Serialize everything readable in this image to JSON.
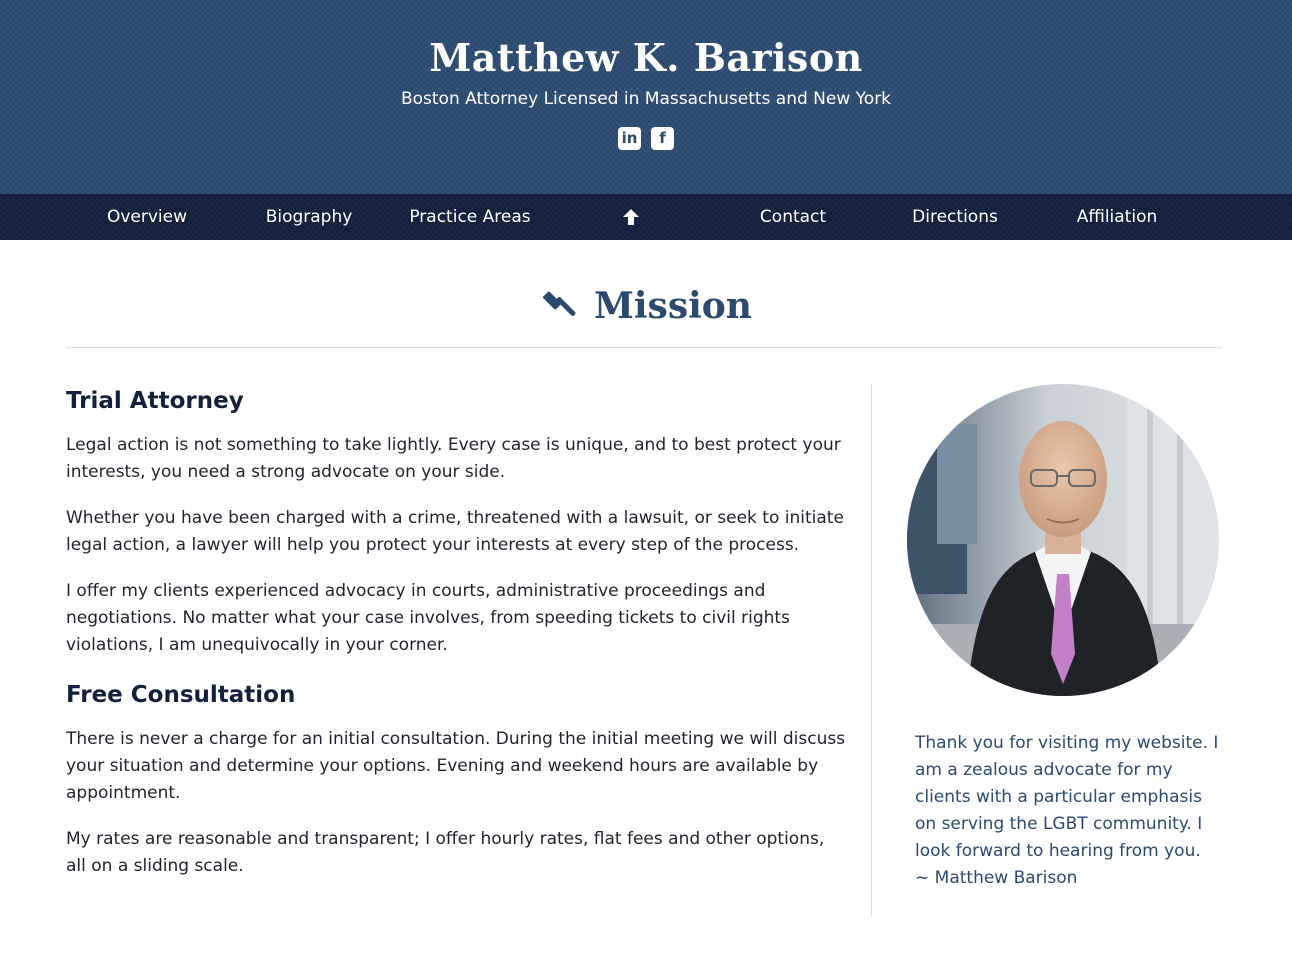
{
  "header": {
    "title": "Matthew K. Barison",
    "subtitle": "Boston Attorney Licensed in Massachusetts and New York",
    "social": [
      {
        "icon": "linkedin-icon",
        "glyph": "in"
      },
      {
        "icon": "facebook-icon",
        "glyph": "f"
      }
    ]
  },
  "nav": {
    "items": [
      "Overview",
      "Biography",
      "Practice Areas",
      "Contact",
      "Directions",
      "Affiliation"
    ],
    "up_icon": "arrow-up-icon"
  },
  "section": {
    "icon": "gavel-icon",
    "title": "Mission"
  },
  "main": {
    "heading1": "Trial Attorney",
    "p1": "Legal action is not something to take lightly. Every case is unique, and to best protect your interests, you need a strong advocate on your side.",
    "p2": "Whether you have been charged with a crime, threatened with a lawsuit, or seek to initiate legal action, a lawyer will help you protect your interests at every step of the process.",
    "p3": "I offer my clients experienced advocacy in courts, administrative proceedings and negotiations. No matter what your case involves, from speeding tickets to civil rights violations, I am unequivocally in your corner.",
    "heading2": "Free Consultation",
    "p4": "There is never a charge for an initial consultation. During the initial meeting we will discuss your situation and determine your options. Evening and weekend hours are available by appointment.",
    "p5": "My rates are reasonable and transparent; I offer hourly rates, flat fees and other options, all on a sliding scale."
  },
  "sidebar": {
    "message": "Thank you for visiting my website. I am a zealous advocate for my clients with a particular emphasis on serving the LGBT community. I look forward to hearing from you.",
    "signature": "~ Matthew Barison"
  },
  "colors": {
    "header_bg": "#2c4a70",
    "nav_bg": "#14213c",
    "accent": "#2c4a70"
  }
}
